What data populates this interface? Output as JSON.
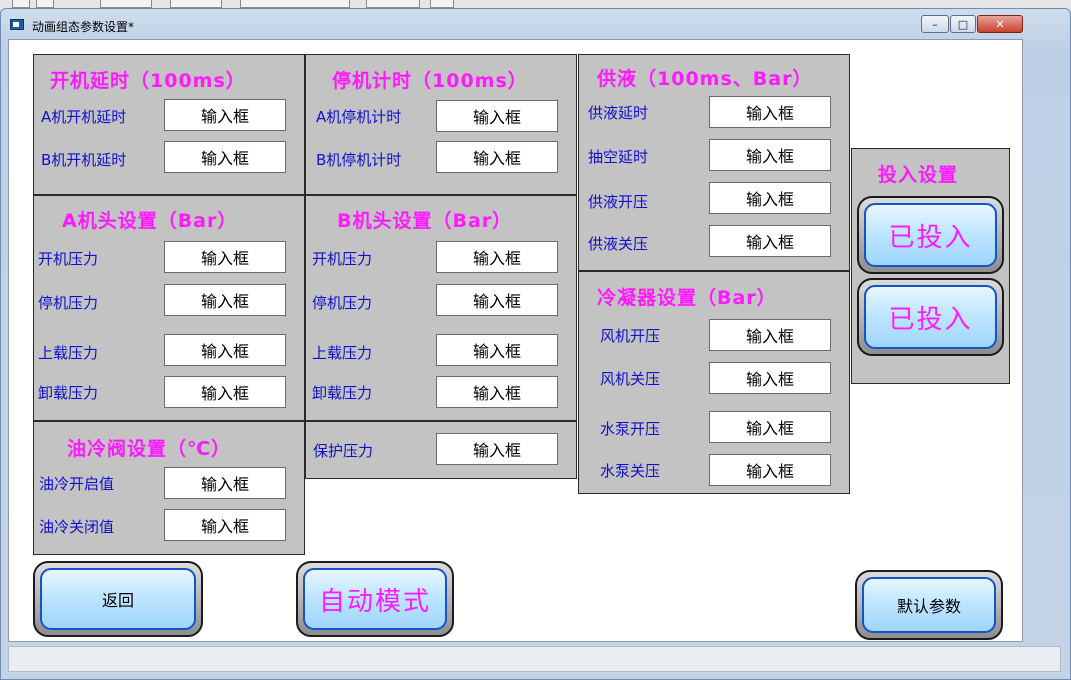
{
  "window": {
    "title": "动画组态参数设置*",
    "controls": {
      "minimize": "–",
      "maximize": "□",
      "close": "✕"
    }
  },
  "panels": {
    "start_delay": {
      "title": "开机延时（100ms）",
      "rows": [
        {
          "label": "A机开机延时",
          "value": "输入框"
        },
        {
          "label": "B机开机延时",
          "value": "输入框"
        }
      ]
    },
    "stop_timer": {
      "title": "停机计时（100ms）",
      "rows": [
        {
          "label": "A机停机计时",
          "value": "输入框"
        },
        {
          "label": "B机停机计时",
          "value": "输入框"
        }
      ]
    },
    "liquid_supply": {
      "title": "供液（100ms、Bar）",
      "rows": [
        {
          "label": "供液延时",
          "value": "输入框"
        },
        {
          "label": "抽空延时",
          "value": "输入框"
        },
        {
          "label": "供液开压",
          "value": "输入框"
        },
        {
          "label": "供液关压",
          "value": "输入框"
        }
      ]
    },
    "head_a": {
      "title": "A机头设置（Bar）",
      "rows": [
        {
          "label": "开机压力",
          "value": "输入框"
        },
        {
          "label": "停机压力",
          "value": "输入框"
        },
        {
          "label": "上载压力",
          "value": "输入框"
        },
        {
          "label": "卸载压力",
          "value": "输入框"
        }
      ]
    },
    "head_b": {
      "title": "B机头设置（Bar）",
      "rows": [
        {
          "label": "开机压力",
          "value": "输入框"
        },
        {
          "label": "停机压力",
          "value": "输入框"
        },
        {
          "label": "上载压力",
          "value": "输入框"
        },
        {
          "label": "卸载压力",
          "value": "输入框"
        }
      ]
    },
    "condenser": {
      "title": "冷凝器设置（Bar）",
      "rows": [
        {
          "label": "风机开压",
          "value": "输入框"
        },
        {
          "label": "风机关压",
          "value": "输入框"
        },
        {
          "label": "水泵开压",
          "value": "输入框"
        },
        {
          "label": "水泵关压",
          "value": "输入框"
        }
      ]
    },
    "oil_cooler": {
      "title": "油冷阀设置（℃）",
      "rows": [
        {
          "label": "油冷开启值",
          "value": "输入框"
        },
        {
          "label": "油冷关闭值",
          "value": "输入框"
        }
      ]
    },
    "protection": {
      "rows": [
        {
          "label": "保护压力",
          "value": "输入框"
        }
      ]
    },
    "commission": {
      "title": "投入设置",
      "buttons": [
        "已投入",
        "已投入"
      ]
    }
  },
  "buttons": {
    "back": "返回",
    "auto_mode": "自动模式",
    "default_params": "默认参数"
  }
}
